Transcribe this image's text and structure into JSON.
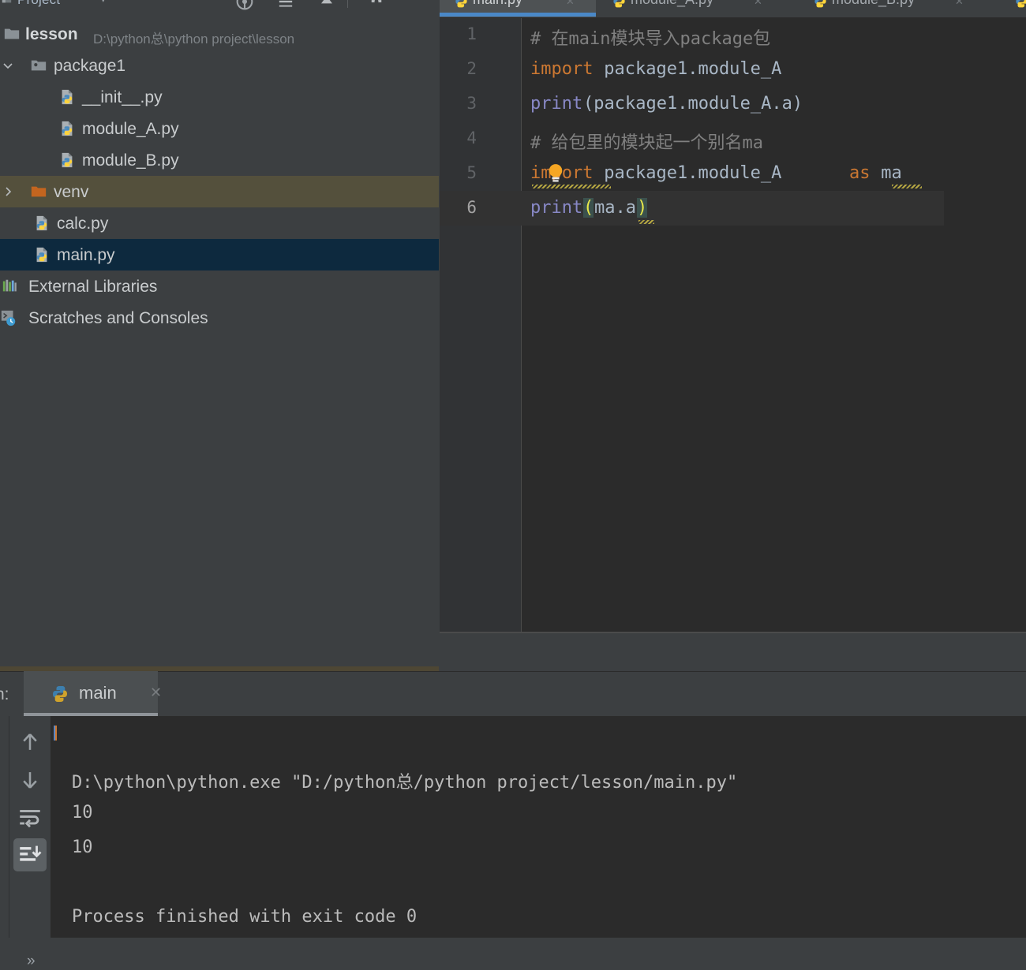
{
  "theme": {
    "bg_panel": "#3c3f41",
    "bg_editor": "#2b2b2b",
    "accent_tab": "#4a88c7",
    "selection": "#0d293e",
    "excluded": "#54503c",
    "text": "#a9b7c6",
    "keyword": "#cc7832",
    "comment": "#808080",
    "function": "#8888c6"
  },
  "toolbar": {
    "title": "Project",
    "dropdown_icon": "chevron-down-icon",
    "icons": [
      {
        "name": "locate-icon",
        "label": "Select Opened File"
      },
      {
        "name": "collapse-all-icon",
        "label": "Collapse All"
      },
      {
        "name": "hide-icon",
        "label": "Hide"
      },
      {
        "name": "settings-gear-icon",
        "label": "Options"
      }
    ]
  },
  "tabs": [
    {
      "label": "main.py",
      "icon": "python-file-icon",
      "active": true,
      "close": "×"
    },
    {
      "label": "module_A.py",
      "icon": "python-file-icon",
      "active": false,
      "close": "×"
    },
    {
      "label": "module_B.py",
      "icon": "python-file-icon",
      "active": false,
      "close": "×"
    },
    {
      "label": "",
      "icon": "python-file-icon",
      "active": false,
      "close": ""
    }
  ],
  "project_tree": {
    "items": [
      {
        "label": "lesson",
        "sub": "D:\\python总\\python project\\lesson",
        "icon": "folder-icon",
        "indent": 0,
        "arrow": "",
        "state": "root"
      },
      {
        "label": "package1",
        "sub": "",
        "icon": "package-folder-icon",
        "indent": 1,
        "arrow": "chevron-down-icon",
        "state": "expanded"
      },
      {
        "label": "__init__.py",
        "sub": "",
        "icon": "python-file-icon",
        "indent": 2,
        "arrow": "",
        "state": "normal"
      },
      {
        "label": "module_A.py",
        "sub": "",
        "icon": "python-file-icon",
        "indent": 2,
        "arrow": "",
        "state": "normal"
      },
      {
        "label": "module_B.py",
        "sub": "",
        "icon": "python-file-icon",
        "indent": 2,
        "arrow": "",
        "state": "normal"
      },
      {
        "label": "venv",
        "sub": "",
        "icon": "excluded-folder-icon",
        "indent": 1,
        "arrow": "chevron-right-icon",
        "state": "excluded"
      },
      {
        "label": "calc.py",
        "sub": "",
        "icon": "python-file-icon",
        "indent": 1,
        "arrow": "",
        "state": "normal"
      },
      {
        "label": "main.py",
        "sub": "",
        "icon": "python-file-icon",
        "indent": 1,
        "arrow": "",
        "state": "selected"
      },
      {
        "label": "External Libraries",
        "sub": "",
        "icon": "libraries-icon",
        "indent": 0,
        "arrow": "",
        "state": "normal"
      },
      {
        "label": "Scratches and Consoles",
        "sub": "",
        "icon": "scratches-icon",
        "indent": 0,
        "arrow": "",
        "state": "normal"
      }
    ]
  },
  "editor": {
    "filename": "main.py",
    "current_line": 6,
    "line_numbers": [
      "1",
      "2",
      "3",
      "4",
      "5",
      "6"
    ],
    "lines": [
      {
        "n": "1",
        "tokens": [
          {
            "t": "# 在main模块导入package包",
            "c": "cmt"
          }
        ]
      },
      {
        "n": "2",
        "tokens": [
          {
            "t": "import",
            "c": "kw"
          },
          {
            "t": " package1.module_A",
            "c": "pl"
          }
        ]
      },
      {
        "n": "3",
        "tokens": [
          {
            "t": "print",
            "c": "fn"
          },
          {
            "t": "(package1.module_A.a)",
            "c": "pl"
          }
        ]
      },
      {
        "n": "4",
        "tokens": [
          {
            "t": "# 给包里的模块起一个别名ma",
            "c": "cmt"
          }
        ]
      },
      {
        "n": "5",
        "tokens": [
          {
            "t": "import",
            "c": "kw"
          },
          {
            "t": " package1.module_A ",
            "c": "pl"
          },
          {
            "t": "as",
            "c": "kw"
          },
          {
            "t": " ma",
            "c": "pl"
          }
        ]
      },
      {
        "n": "6",
        "tokens": [
          {
            "t": "print",
            "c": "fn"
          },
          {
            "t": "(",
            "c": "paren mtch"
          },
          {
            "t": "ma.a",
            "c": "pl"
          },
          {
            "t": ")",
            "c": "paren mtch"
          }
        ]
      }
    ],
    "intention_bulb": "lightbulb-icon",
    "warning_underlines": [
      "import",
      "ma"
    ]
  },
  "run_panel": {
    "header_label": "n:",
    "tab_label": "main",
    "tab_icon": "python-icon",
    "tab_close": "×",
    "side_buttons": [
      {
        "name": "up-arrow-icon",
        "label": "Up the Stack Trace",
        "active": false
      },
      {
        "name": "down-arrow-icon",
        "label": "Down the Stack Trace",
        "active": false
      },
      {
        "name": "soft-wrap-icon",
        "label": "Soft-Wrap",
        "active": false
      },
      {
        "name": "scroll-to-end-icon",
        "label": "Scroll to End",
        "active": true
      }
    ],
    "overflow_label": "»",
    "output": [
      "D:\\python\\python.exe \"D:/python总/python project/lesson/main.py\"",
      "10",
      "10",
      "",
      "Process finished with exit code 0"
    ]
  }
}
